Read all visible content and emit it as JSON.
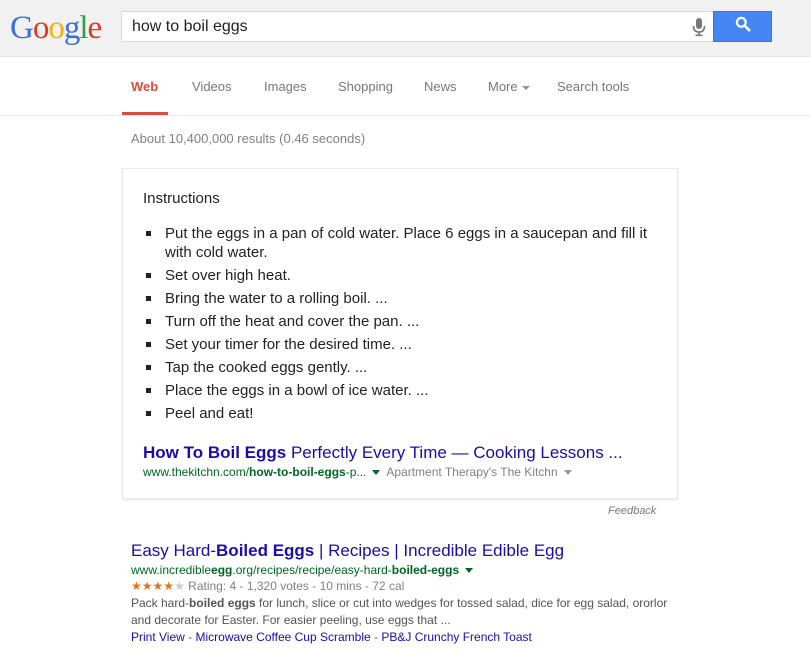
{
  "logo": {
    "letters": [
      "G",
      "o",
      "o",
      "g",
      "l",
      "e"
    ]
  },
  "search": {
    "query": "how to boil eggs",
    "mic_icon": "microphone-icon",
    "button_icon": "search-icon"
  },
  "tabs": [
    {
      "label": "Web",
      "active": true
    },
    {
      "label": "Videos"
    },
    {
      "label": "Images"
    },
    {
      "label": "Shopping"
    },
    {
      "label": "News"
    },
    {
      "label": "More"
    },
    {
      "label": "Search tools"
    }
  ],
  "results_stats": "About 10,400,000 results (0.46 seconds)",
  "answer_card": {
    "heading": "Instructions",
    "steps": [
      "Put the eggs in a pan of cold water. Place 6 eggs in a saucepan and fill it with cold water.",
      "Set over high heat.",
      "Bring the water to a rolling boil. ...",
      "Turn off the heat and cover the pan. ...",
      "Set your timer for the desired time. ...",
      "Tap the cooked eggs gently. ...",
      "Place the eggs in a bowl of ice water. ...",
      "Peel and eat!"
    ],
    "title_bold": "How To Boil Eggs",
    "title_rest": " Perfectly Every Time — Cooking Lessons ...",
    "url_prefix": "www.thekitchn.com/",
    "url_bold": "how-to-boil-eggs",
    "url_suffix": "-p...",
    "source": "Apartment Therapy's The Kitchn",
    "feedback": "Feedback"
  },
  "result": {
    "title_pre": "Easy Hard-",
    "title_bold": "Boiled Eggs",
    "title_post": " | Recipes | Incredible Edible Egg",
    "url_pre": "www.incredible",
    "url_bold1": "egg",
    "url_mid": ".org/recipes/recipe/easy-hard-",
    "url_bold2": "boiled-eggs",
    "rating_value": 4,
    "rating_max": 5,
    "rating_text": "Rating: 4 - 1,320 votes - 10 mins - 72 cal",
    "snippet_pre": "Pack hard-",
    "snippet_bold": "boiled eggs",
    "snippet_post": " for lunch, slice or cut into wedges for tossed salad, dice for egg salad, ororlor and decorate for Easter. For easier peeling, use eggs that ...",
    "sitelinks": [
      "Print View",
      "Microwave Coffee Cup Scramble",
      "PB&J Crunchy French Toast"
    ]
  },
  "colors": {
    "link_blue": "#1a0dab",
    "url_green": "#006621",
    "active_tab_red": "#dd4b39",
    "search_button_blue": "#4486f4",
    "star_orange": "#e7711b"
  }
}
